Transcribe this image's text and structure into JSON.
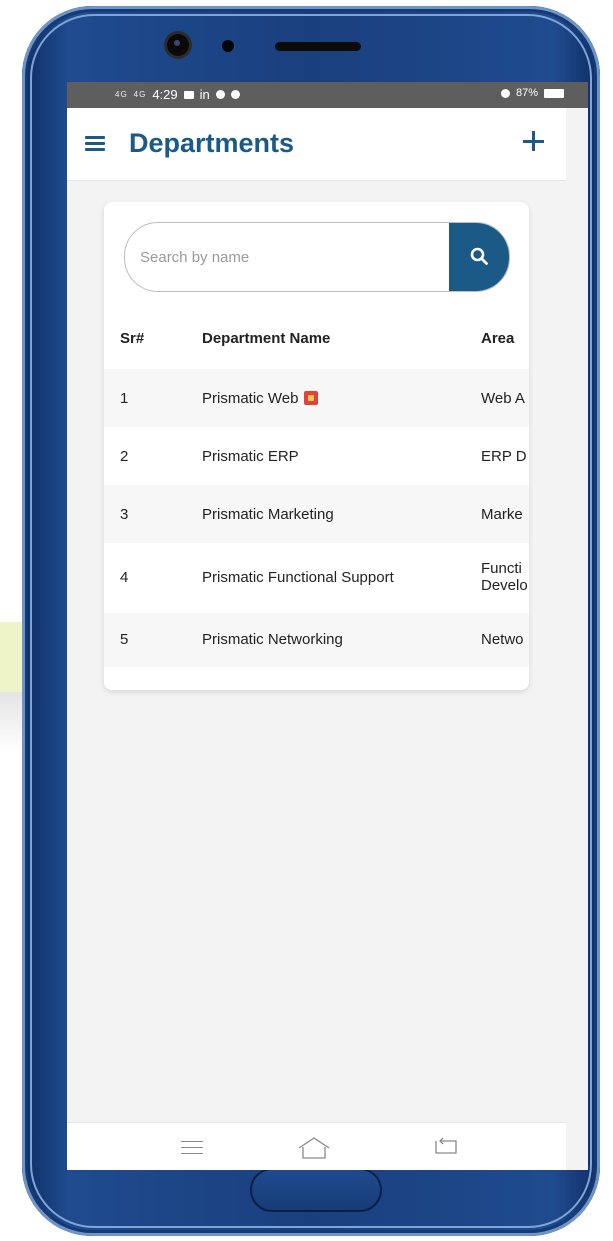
{
  "status_bar": {
    "time": "4:29",
    "signal_left": "4G",
    "signal_right": "4G",
    "app_in": "in",
    "battery": "87%"
  },
  "app_bar": {
    "title": "Departments"
  },
  "search": {
    "placeholder": "Search by name",
    "value": ""
  },
  "table": {
    "headers": {
      "sr": "Sr#",
      "name": "Department Name",
      "area": "Area"
    },
    "rows": [
      {
        "sr": "1",
        "name": "Prismatic Web",
        "area": "Web A"
      },
      {
        "sr": "2",
        "name": "Prismatic ERP",
        "area": "ERP D"
      },
      {
        "sr": "3",
        "name": "Prismatic Marketing",
        "area": "Marke"
      },
      {
        "sr": "4",
        "name": "Prismatic Functional Support",
        "area_line1": "Functi",
        "area_line2": "Develo"
      },
      {
        "sr": "5",
        "name": "Prismatic Networking",
        "area": "Netwo"
      }
    ]
  },
  "colors": {
    "primary": "#1b5a86",
    "background": "#f3f3f4",
    "phone_frame": "#1a3f7e"
  },
  "icons": {
    "menu": "hamburger-menu-icon",
    "add": "plus-icon",
    "search": "magnifier-icon",
    "row_badge": "notification-badge-icon",
    "nav_recent": "recent-apps-icon",
    "nav_home": "home-icon",
    "nav_back": "back-icon"
  }
}
